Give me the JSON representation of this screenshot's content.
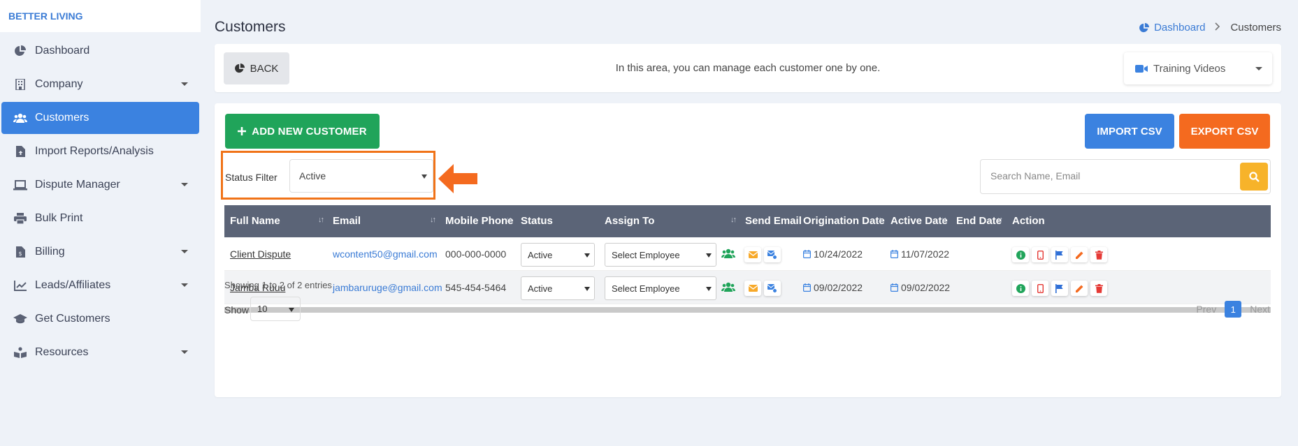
{
  "brand": "BETTER LIVING",
  "sidebar": {
    "items": [
      {
        "label": "Dashboard"
      },
      {
        "label": "Company"
      },
      {
        "label": "Customers"
      },
      {
        "label": "Import Reports/Analysis"
      },
      {
        "label": "Dispute Manager"
      },
      {
        "label": "Bulk Print"
      },
      {
        "label": "Billing"
      },
      {
        "label": "Leads/Affiliates"
      },
      {
        "label": "Get Customers"
      },
      {
        "label": "Resources"
      }
    ]
  },
  "header": {
    "title": "Customers",
    "breadcrumb": {
      "home": "Dashboard",
      "current": "Customers"
    }
  },
  "topbar": {
    "back_label": "BACK",
    "info": "In this area, you can manage each customer one by one.",
    "training_label": "Training Videos"
  },
  "toolbar": {
    "add_label": "ADD NEW CUSTOMER",
    "import_label": "IMPORT CSV",
    "export_label": "EXPORT CSV"
  },
  "filter": {
    "label": "Status Filter",
    "value": "Active"
  },
  "search": {
    "placeholder": "Search Name, Email"
  },
  "table": {
    "columns": [
      "Full Name",
      "Email",
      "Mobile Phone",
      "Status",
      "Assign To",
      "Send Email",
      "Origination Date",
      "Active Date",
      "End Date",
      "Action"
    ],
    "rows": [
      {
        "name": "Client Dispute",
        "email": "wcontent50@gmail.com",
        "phone": "000-000-0000",
        "status": "Active",
        "assign": "Select Employee",
        "origination": "10/24/2022",
        "active": "11/07/2022",
        "end": ""
      },
      {
        "name": "Jamba Ruuu",
        "email": "jambaruruge@gmail.com",
        "phone": "545-454-5464",
        "status": "Active",
        "assign": "Select Employee",
        "origination": "09/02/2022",
        "active": "09/02/2022",
        "end": ""
      }
    ]
  },
  "footer": {
    "showing": "Showing 1 to 2 of 2 entries",
    "show_label": "Show",
    "page_size": "10",
    "prev": "Prev",
    "page": "1",
    "next": "Next"
  },
  "colors": {
    "accent": "#3b82e0",
    "add_green": "#20a45a",
    "export_orange": "#f46a1f",
    "highlight_orange": "#f07318",
    "search_yellow": "#f7b32a",
    "table_header": "#5b6477"
  }
}
